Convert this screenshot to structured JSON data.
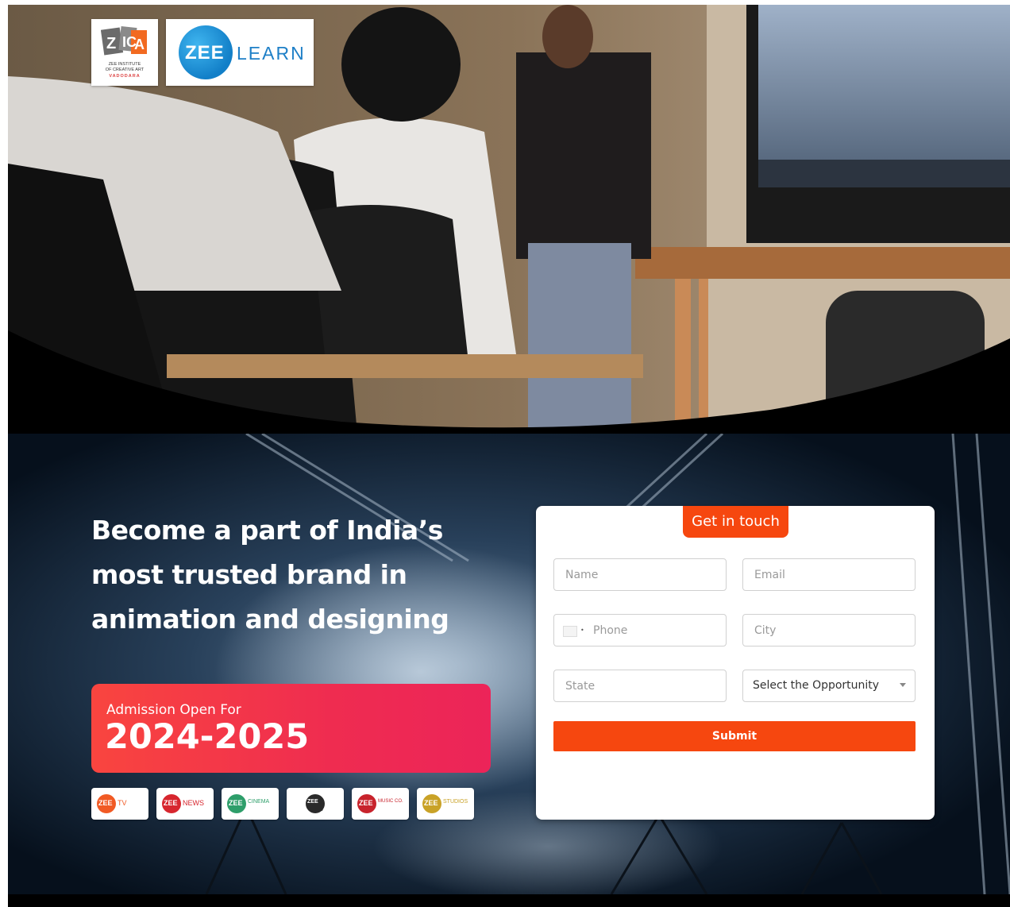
{
  "logos": {
    "zica": {
      "letters": "ZICA",
      "caption_line1": "ZEE INSTITUTE",
      "caption_line2": "OF CREATIVE ART",
      "caption_line3": "VADODARA"
    },
    "zeelearn": {
      "zee": "ZEE",
      "learn": "LEARN"
    }
  },
  "promo": {
    "headline_lines": [
      "Become a part of India’s",
      "most trusted brand in",
      "animation and designing"
    ],
    "admission_label": "Admission Open For",
    "admission_years": "2024-2025"
  },
  "brands": [
    {
      "prefix": "ZEE",
      "suffix": "TV",
      "color": "#f15a24"
    },
    {
      "prefix": "ZEE",
      "suffix": "NEWS",
      "color": "#d7262e"
    },
    {
      "prefix": "ZEE",
      "suffix": "CINEMA",
      "color": "#2e9e6a"
    },
    {
      "prefix": "ZEE",
      "suffix": "5",
      "color": "#2a2a2a"
    },
    {
      "prefix": "ZEE",
      "suffix": "MUSIC CO.",
      "color": "#c8232c"
    },
    {
      "prefix": "ZEE",
      "suffix": "STUDIOS",
      "color": "#c9a227"
    }
  ],
  "form": {
    "title": "Get in touch",
    "name_placeholder": "Name",
    "email_placeholder": "Email",
    "phone_placeholder": "Phone",
    "city_placeholder": "City",
    "state_placeholder": "State",
    "opportunity_value": "Select the Opportunity",
    "submit_label": "Submit"
  },
  "colors": {
    "accent": "#f6470f",
    "admission_gradient_start": "#f9453f",
    "admission_gradient_end": "#ec2459",
    "zee_blue": "#1e7fc7"
  }
}
